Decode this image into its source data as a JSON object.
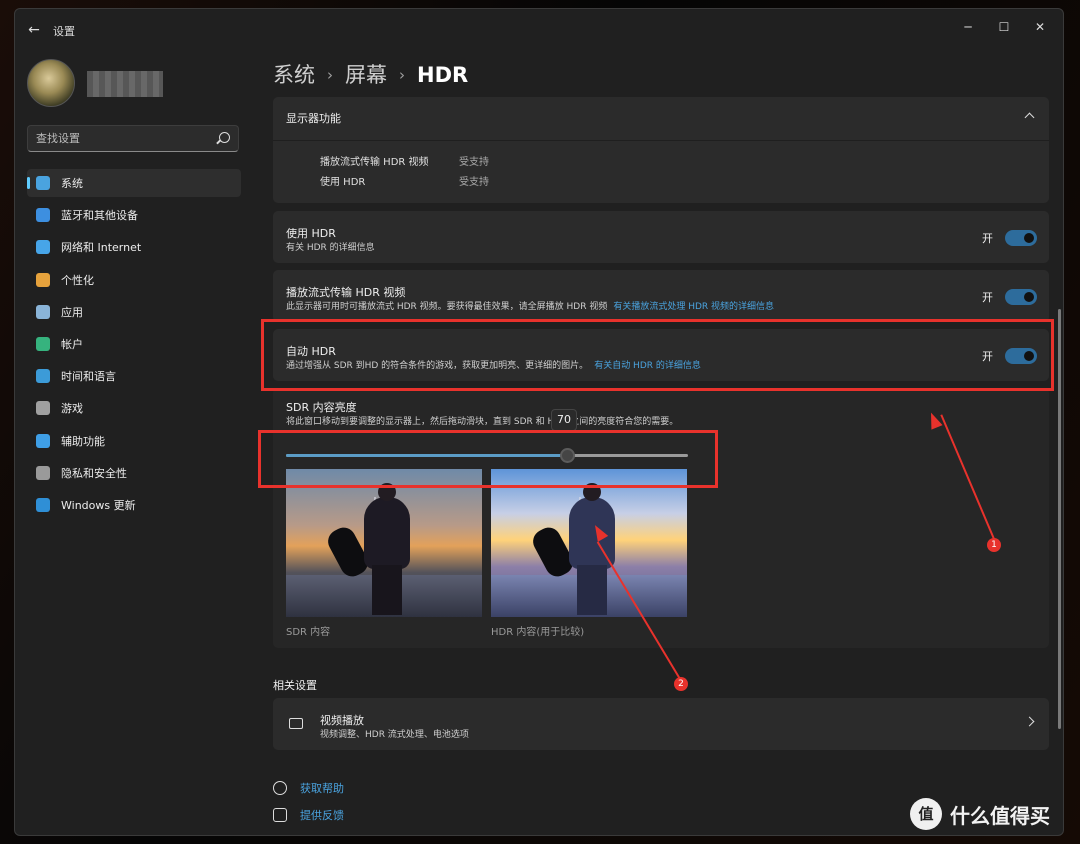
{
  "window": {
    "app_title": "设置",
    "back_glyph": "←",
    "controls": {
      "minimize": "─",
      "maximize": "☐",
      "close": "✕"
    }
  },
  "search": {
    "placeholder": "查找设置"
  },
  "sidebar": {
    "items": [
      {
        "label": "系统",
        "icon": "monitor-icon",
        "color": "#4aa3df",
        "active": true
      },
      {
        "label": "蓝牙和其他设备",
        "icon": "bluetooth-icon",
        "color": "#3d8fe0"
      },
      {
        "label": "网络和 Internet",
        "icon": "wifi-icon",
        "color": "#47a5e8"
      },
      {
        "label": "个性化",
        "icon": "brush-icon",
        "color": "#e6a23c"
      },
      {
        "label": "应用",
        "icon": "apps-icon",
        "color": "#8ab4d8"
      },
      {
        "label": "帐户",
        "icon": "person-icon",
        "color": "#36b37e"
      },
      {
        "label": "时间和语言",
        "icon": "globe-clock-icon",
        "color": "#3c9bd8"
      },
      {
        "label": "游戏",
        "icon": "gamepad-icon",
        "color": "#a0a0a0"
      },
      {
        "label": "辅助功能",
        "icon": "accessibility-icon",
        "color": "#3f9fe6"
      },
      {
        "label": "隐私和安全性",
        "icon": "shield-icon",
        "color": "#9a9a9a"
      },
      {
        "label": "Windows 更新",
        "icon": "update-icon",
        "color": "#2f8fd6"
      }
    ]
  },
  "breadcrumb": {
    "level1": "系统",
    "level2": "屏幕",
    "current": "HDR",
    "sep": "›"
  },
  "display_features": {
    "title": "显示器功能",
    "rows": [
      {
        "name": "播放流式传输 HDR 视频",
        "value": "受支持"
      },
      {
        "name": "使用 HDR",
        "value": "受支持"
      }
    ]
  },
  "use_hdr": {
    "title": "使用 HDR",
    "link": "有关 HDR 的详细信息",
    "state": "开"
  },
  "stream_hdr": {
    "title": "播放流式传输 HDR 视频",
    "desc": "此显示器可用时可播放流式 HDR 视频。要获得最佳效果，请全屏播放 HDR 视频",
    "link": "有关播放流式处理 HDR 视频的详细信息",
    "state": "开"
  },
  "auto_hdr": {
    "title": "自动 HDR",
    "desc": "通过增强从 SDR 到HD 的符合条件的游戏，获取更加明亮、更详细的图片。",
    "link": "有关自动 HDR 的详细信息",
    "state": "开"
  },
  "sdr_brightness": {
    "title": "SDR 内容亮度",
    "desc": "将此窗口移动到要调整的显示器上，然后拖动滑块，直到 SDR 和 HDR 之间的亮度符合您的需要。",
    "value": 70,
    "value_label": "70",
    "max": 100,
    "caption_sdr": "SDR 内容",
    "caption_hdr": "HDR 内容(用于比较)"
  },
  "related": {
    "section_title": "相关设置",
    "video": {
      "title": "视频播放",
      "desc": "视频调整、HDR 流式处理、电池选项"
    }
  },
  "help": {
    "get_help": "获取帮助",
    "feedback": "提供反馈"
  },
  "annotations": {
    "badge1": "1",
    "badge2": "2",
    "color": "#e8322c"
  },
  "watermark": {
    "logo": "值",
    "text": "什么值得买"
  }
}
